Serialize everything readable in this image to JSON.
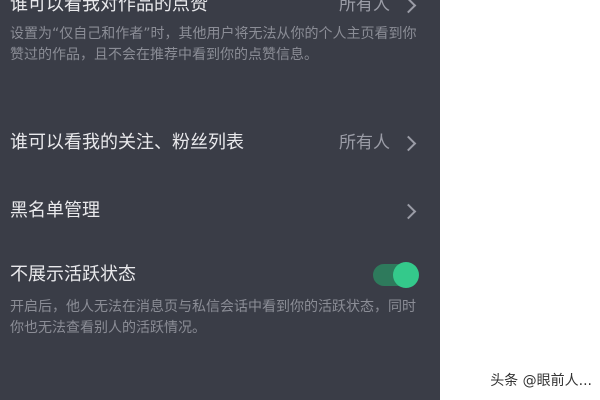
{
  "settings": {
    "like_visibility": {
      "title": "谁可以看我对作品的点赞",
      "value": "所有人",
      "description": "设置为“仅自己和作者”时，其他用户将无法从你的个人主页看到你赞过的作品，且不会在推荐中看到你的点赞信息。"
    },
    "follow_list": {
      "title": "谁可以看我的关注、粉丝列表",
      "value": "所有人"
    },
    "blacklist": {
      "title": "黑名单管理"
    },
    "hide_activity": {
      "title": "不展示活跃状态",
      "enabled": true,
      "description": "开启后，他人无法在消息页与私信会话中看到你的活跃状态，同时你也无法查看别人的活跃情况。"
    }
  },
  "watermark": "头条 @眼前人...",
  "icons": {
    "chevron": "chevron-right-icon"
  },
  "colors": {
    "background": "#3a3d47",
    "toggle_on": "#34c98b",
    "text_primary": "#e9e9ec",
    "text_secondary": "#8b8d96"
  }
}
